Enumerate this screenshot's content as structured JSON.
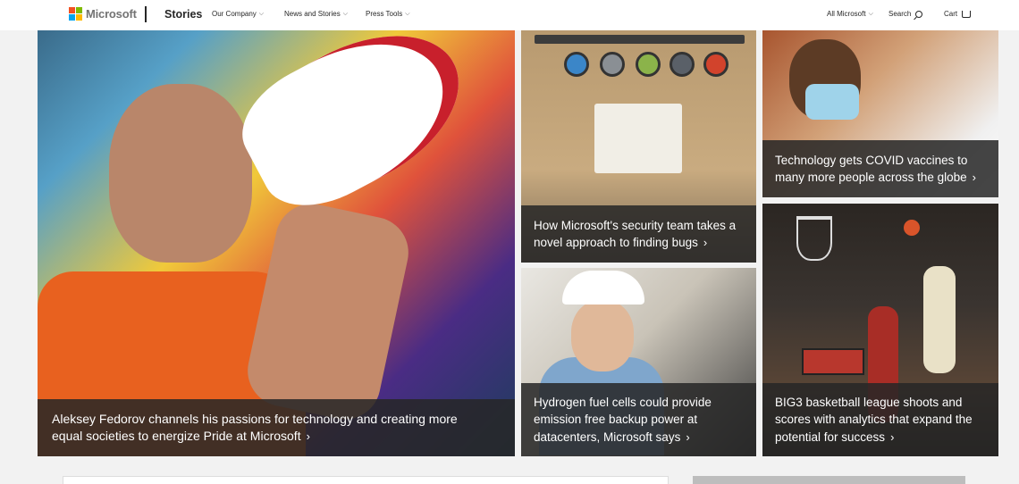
{
  "header": {
    "logo_text": "Microsoft",
    "section_title": "Stories",
    "nav_items": [
      "Our Company",
      "News and Stories",
      "Press Tools"
    ],
    "right_items": {
      "all_microsoft": "All Microsoft",
      "search": "Search",
      "cart": "Cart"
    }
  },
  "stories": {
    "main": {
      "caption": "Aleksey Fedorov channels his passions for technology and creating more equal societies to energize Pride at Microsoft"
    },
    "security": {
      "caption": "How Microsoft's security team takes a novel approach to finding bugs"
    },
    "covid": {
      "caption": "Technology gets COVID vaccines to many more people across the globe"
    },
    "hydrogen": {
      "caption": "Hydrogen fuel cells could provide emission free backup power at datacenters, Microsoft says"
    },
    "basketball": {
      "caption": "BIG3 basketball league shoots and scores with analytics that expand the potential for success"
    }
  },
  "colors": {
    "logo_red": "#f25022",
    "logo_green": "#7fba00",
    "logo_blue": "#00a4ef",
    "logo_yellow": "#ffb900",
    "caption_bg": "#262626"
  },
  "icons": {
    "chevron": "chevron-down-icon",
    "search": "search-icon",
    "cart": "cart-icon",
    "caption_arrow": "chevron-right-icon"
  }
}
